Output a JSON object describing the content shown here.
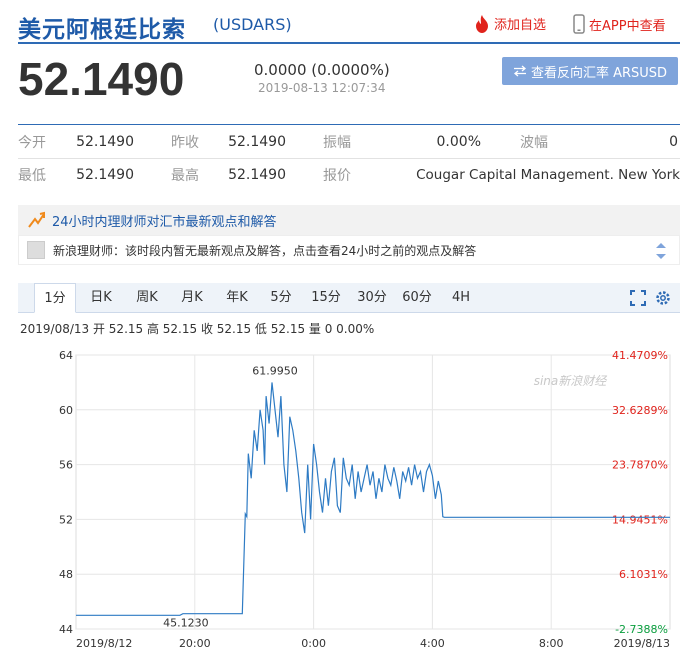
{
  "header": {
    "title": "美元阿根廷比索",
    "code": "(USDARS)",
    "add_watch": "添加自选",
    "app_link": "在APP中查看"
  },
  "quote": {
    "price": "52.1490",
    "change": "0.0000 (0.0000%)",
    "time": "2019-08-13 12:07:34",
    "reverse_label": "查看反向汇率 ARSUSD",
    "rows": [
      [
        {
          "label": "今开",
          "value": "52.1490"
        },
        {
          "label": "昨收",
          "value": "52.1490"
        },
        {
          "label": "振幅",
          "value": "0.00%"
        },
        {
          "label": "波幅",
          "value": "0"
        }
      ],
      [
        {
          "label": "最低",
          "value": "52.1490"
        },
        {
          "label": "最高",
          "value": "52.1490"
        },
        {
          "label": "报价",
          "value": "Cougar Capital Management. New York"
        }
      ]
    ]
  },
  "expert": {
    "banner": "24小时内理财师对汇市最新观点和解答",
    "message": "新浪理财师：该时段内暂无最新观点及解答，点击查看24小时之前的观点及解答"
  },
  "tabs": [
    "1分",
    "日K",
    "周K",
    "月K",
    "年K",
    "5分",
    "15分",
    "30分",
    "60分",
    "4H"
  ],
  "active_tab": "1分",
  "bar_info": "2019/08/13 开 52.15 高 52.15 收 52.15 低 52.15 量 0 0.00%",
  "chart_data": {
    "type": "line",
    "x_ticks": [
      "2019/8/12",
      "20:00",
      "0:00",
      "4:00",
      "8:00",
      "2019/8/13"
    ],
    "y_ticks": [
      44,
      48,
      52,
      56,
      60,
      64
    ],
    "pct_ticks": [
      "-2.7388%",
      "6.1031%",
      "14.9451%",
      "23.7870%",
      "32.6289%",
      "41.4709%"
    ],
    "ylim": [
      44,
      64
    ],
    "max_label": "61.9950",
    "min_label": "45.1230",
    "watermark": "sina新浪财经",
    "colors": {
      "line": "#2e7bc4",
      "grid": "#e6e6e6",
      "pct_pos": "#e0231c",
      "pct_neg": "#0a9e3e"
    },
    "series": [
      {
        "hours": [
          16,
          19.5,
          19.6,
          21.6,
          21.7,
          21.75,
          21.8,
          21.9,
          22.0,
          22.1,
          22.2,
          22.3,
          22.35,
          22.4,
          22.5,
          22.6,
          22.7,
          22.8,
          22.9,
          23.0,
          23.1,
          23.2,
          23.3,
          23.4,
          23.5,
          23.6,
          23.7,
          23.8,
          23.9,
          24.0,
          24.1,
          24.2,
          24.3,
          24.4,
          24.5,
          24.6,
          24.7,
          24.8,
          24.9,
          25.0,
          25.1,
          25.2,
          25.3,
          25.4,
          25.5,
          25.6,
          25.7,
          25.8,
          25.9,
          26.0,
          26.1,
          26.2,
          26.3,
          26.4,
          26.5,
          26.6,
          26.7,
          26.8,
          26.9,
          27.0,
          27.1,
          27.2,
          27.3,
          27.4,
          27.5,
          27.6,
          27.7,
          27.8,
          27.9,
          28.0,
          28.1,
          28.2,
          28.3,
          28.35,
          28.4,
          36
        ],
        "values": [
          45.0,
          45.0,
          45.12,
          45.12,
          52.4,
          52.2,
          56.8,
          55.0,
          58.5,
          57.0,
          60.0,
          58.5,
          56.0,
          61.0,
          59.0,
          62.0,
          60.0,
          58.0,
          61.0,
          56.0,
          54.0,
          59.5,
          58.5,
          57.0,
          55.0,
          52.5,
          51.0,
          56.0,
          52.0,
          57.5,
          56.0,
          54.0,
          52.5,
          55.0,
          53.0,
          55.5,
          56.5,
          53.0,
          52.5,
          56.5,
          55.0,
          54.5,
          56.0,
          53.5,
          55.5,
          54.0,
          55.0,
          56.0,
          54.5,
          55.5,
          53.5,
          55.0,
          54.0,
          56.0,
          55.0,
          54.5,
          55.8,
          54.8,
          53.5,
          55.5,
          54.8,
          55.8,
          54.5,
          56.0,
          55.0,
          55.5,
          54.0,
          55.5,
          56.0,
          55.2,
          53.5,
          54.8,
          53.8,
          52.2,
          52.15,
          52.15
        ]
      }
    ]
  }
}
